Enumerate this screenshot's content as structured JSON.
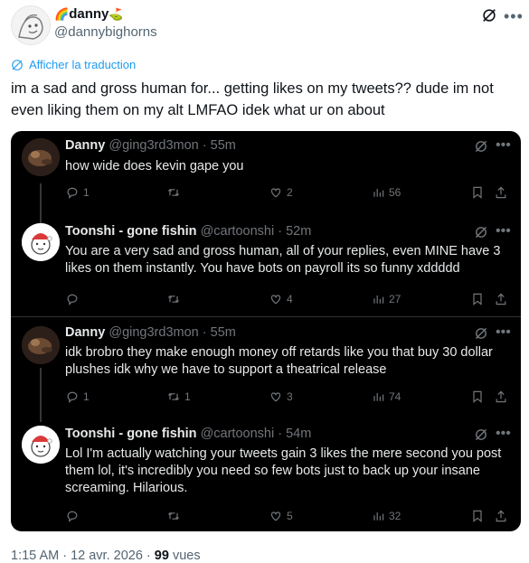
{
  "author": {
    "prefix_emoji": "🌈",
    "name": "danny",
    "suffix_emoji": "⛳",
    "handle": "@dannybighorns"
  },
  "translate_label": "Afficher la traduction",
  "tweet_text": "im a sad and gross human for... getting likes on my tweets??  dude im not even liking them on my alt LMFAO idek what ur on about",
  "quoted": [
    {
      "name": "Danny",
      "handle": "@ging3rd3mon",
      "time": "55m",
      "text": "how wide does kevin gape you",
      "replies": "1",
      "retweets": "",
      "likes": "2",
      "views": "56"
    },
    {
      "name": "Toonshi - gone fishin",
      "handle": "@cartoonshi",
      "time": "52m",
      "text": "You are a very sad and gross human, all of your replies, even MINE have 3 likes on them instantly. You have bots on payroll its so funny xddddd",
      "replies": "",
      "retweets": "",
      "likes": "4",
      "views": "27"
    },
    {
      "name": "Danny",
      "handle": "@ging3rd3mon",
      "time": "55m",
      "text": "idk brobro they make enough money off retards like you that buy 30 dollar plushes idk why we have to support a theatrical release",
      "replies": "1",
      "retweets": "1",
      "likes": "3",
      "views": "74"
    },
    {
      "name": "Toonshi - gone fishin",
      "handle": "@cartoonshi",
      "time": "54m",
      "text": "Lol I'm actually watching your tweets gain 3 likes the mere second you post them lol, it's incredibly you need so few bots just to back up your insane screaming. Hilarious.",
      "replies": "",
      "retweets": "",
      "likes": "5",
      "views": "32"
    }
  ],
  "footer": {
    "timestamp": "1:15 AM · 12 avr. 2026 · ",
    "views_count": "99",
    "views_label": " vues"
  },
  "colors": {
    "link": "#1d9bf0",
    "muted": "#536471",
    "card_bg": "#000000",
    "card_text": "#e7e9ea",
    "card_muted": "#71767b"
  }
}
